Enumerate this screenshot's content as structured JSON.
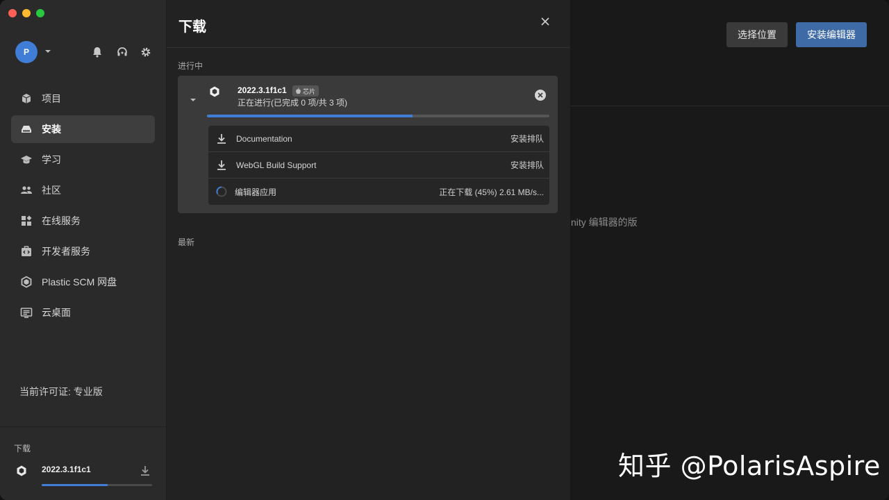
{
  "sidebar": {
    "avatar_initial": "P",
    "nav": [
      {
        "label": "项目"
      },
      {
        "label": "安装"
      },
      {
        "label": "学习"
      },
      {
        "label": "社区"
      },
      {
        "label": "在线服务"
      },
      {
        "label": "开发者服务"
      },
      {
        "label": "Plastic SCM 网盘"
      },
      {
        "label": "云桌面"
      }
    ],
    "license": "当前许可证: 专业版",
    "downloads": {
      "title": "下载",
      "version": "2022.3.1f1c1",
      "progress_fraction": 0.6
    }
  },
  "panel": {
    "title": "下载",
    "in_progress_label": "进行中",
    "latest_label": "最新",
    "card": {
      "version": "2022.3.1f1c1",
      "chip": "芯片",
      "status": "正在进行(已完成 0 项/共 3 项)",
      "progress_fraction": 0.6,
      "items": [
        {
          "name": "Documentation",
          "state": "安装排队",
          "icon": "download-icon"
        },
        {
          "name": "WebGL Build Support",
          "state": "安装排队",
          "icon": "download-icon"
        },
        {
          "name": "编辑器应用",
          "state": "正在下载 (45%) 2.61 MB/s...",
          "icon": "spinner-icon"
        }
      ]
    }
  },
  "main": {
    "locate_button": "选择位置",
    "install_button": "安装编辑器",
    "hint": "nity 编辑器的版"
  },
  "watermark": "知乎 @PolarisAspire",
  "colors": {
    "accent": "#3f7dd6",
    "install_button": "#3e6aa6",
    "sidebar_bg": "#2a2a2a",
    "panel_bg": "#222222",
    "card_bg": "#3a3a3a"
  }
}
